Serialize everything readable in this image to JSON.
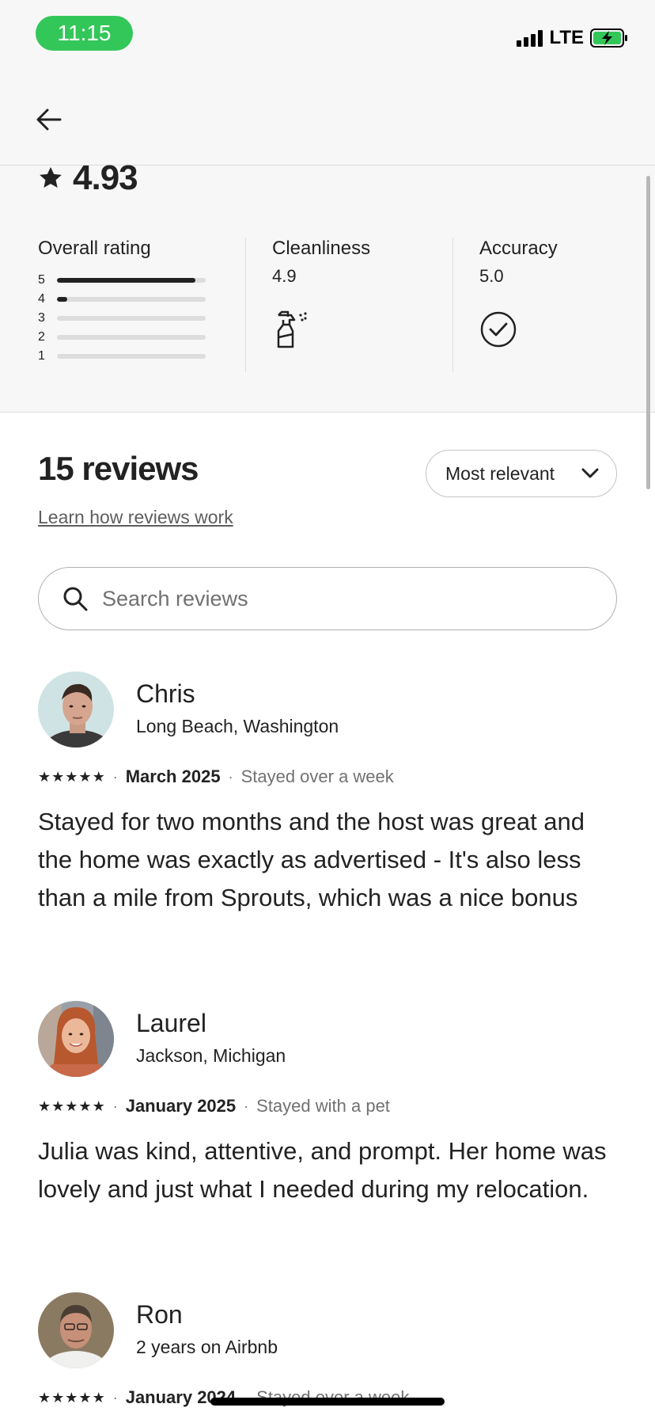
{
  "status_bar": {
    "time": "11:15",
    "network": "LTE"
  },
  "header": {
    "back_icon": "arrow-left-icon"
  },
  "rating": {
    "value": "4.93",
    "overall_label": "Overall rating",
    "distribution": [
      {
        "stars": "5",
        "fraction": 0.93
      },
      {
        "stars": "4",
        "fraction": 0.07
      },
      {
        "stars": "3",
        "fraction": 0
      },
      {
        "stars": "2",
        "fraction": 0
      },
      {
        "stars": "1",
        "fraction": 0
      }
    ],
    "categories": [
      {
        "label": "Cleanliness",
        "value": "4.9",
        "icon": "spray-bottle-icon"
      },
      {
        "label": "Accuracy",
        "value": "5.0",
        "icon": "check-circle-icon"
      }
    ]
  },
  "reviews_section": {
    "title": "15 reviews",
    "learn_link": "Learn how reviews work",
    "sort_label": "Most relevant",
    "search_placeholder": "Search reviews"
  },
  "reviews": [
    {
      "name": "Chris",
      "subtitle": "Long Beach, Washington",
      "stars": 5,
      "date": "March 2025",
      "stay": "Stayed over a week",
      "text": "Stayed for two months and the host was great and the home was exactly as advertised - It's also less than a mile from Sprouts, which was a nice bonus"
    },
    {
      "name": "Laurel",
      "subtitle": "Jackson, Michigan",
      "stars": 5,
      "date": "January 2025",
      "stay": "Stayed with a pet",
      "text": "Julia was kind, attentive, and prompt. Her home was lovely and just what I needed during my relocation."
    },
    {
      "name": "Ron",
      "subtitle": "2 years on Airbnb",
      "stars": 5,
      "date": "January 2024",
      "stay": "Stayed over a week",
      "text": ""
    }
  ],
  "colors": {
    "accent_green": "#33c759",
    "text_primary": "#222222",
    "text_secondary": "#717171"
  }
}
